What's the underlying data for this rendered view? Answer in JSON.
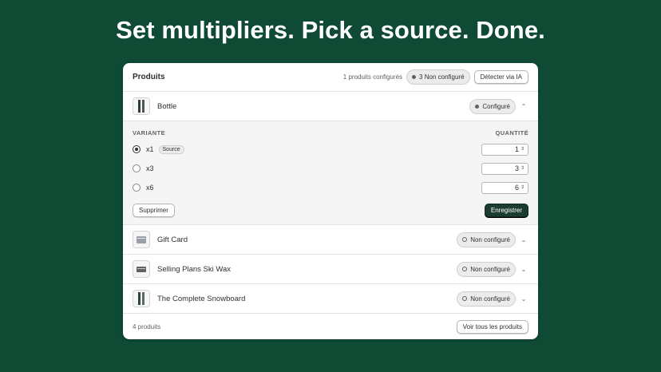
{
  "headline": "Set multipliers. Pick a source. Done.",
  "panel": {
    "title": "Produits",
    "configured_count": "1 produits configurés",
    "not_configured_badge": "3 Non configuré",
    "detect_button": "Détecter via IA"
  },
  "expanded_product": {
    "name": "Bottle",
    "status": "Configuré",
    "variant_header": "VARIANTE",
    "quantity_header": "QUANTITÉ",
    "variants": [
      {
        "label": "x1",
        "selected": true,
        "source_badge": "Source",
        "quantity": "1"
      },
      {
        "label": "x3",
        "selected": false,
        "quantity": "3"
      },
      {
        "label": "x6",
        "selected": false,
        "quantity": "6"
      }
    ],
    "delete_button": "Supprimer",
    "save_button": "Enregistrer"
  },
  "products": [
    {
      "name": "Gift Card",
      "status": "Non configuré"
    },
    {
      "name": "Selling Plans Ski Wax",
      "status": "Non configuré"
    },
    {
      "name": "The Complete Snowboard",
      "status": "Non configuré"
    }
  ],
  "footer": {
    "count": "4 produits",
    "view_all_button": "Voir tous les produits"
  },
  "colors": {
    "background": "#0f4a35",
    "primary_button": "#1b3d2f"
  },
  "icons": {
    "collapse": "chevron-up-icon",
    "expand": "chevron-down-icon",
    "spinner": "stepper-icon"
  }
}
